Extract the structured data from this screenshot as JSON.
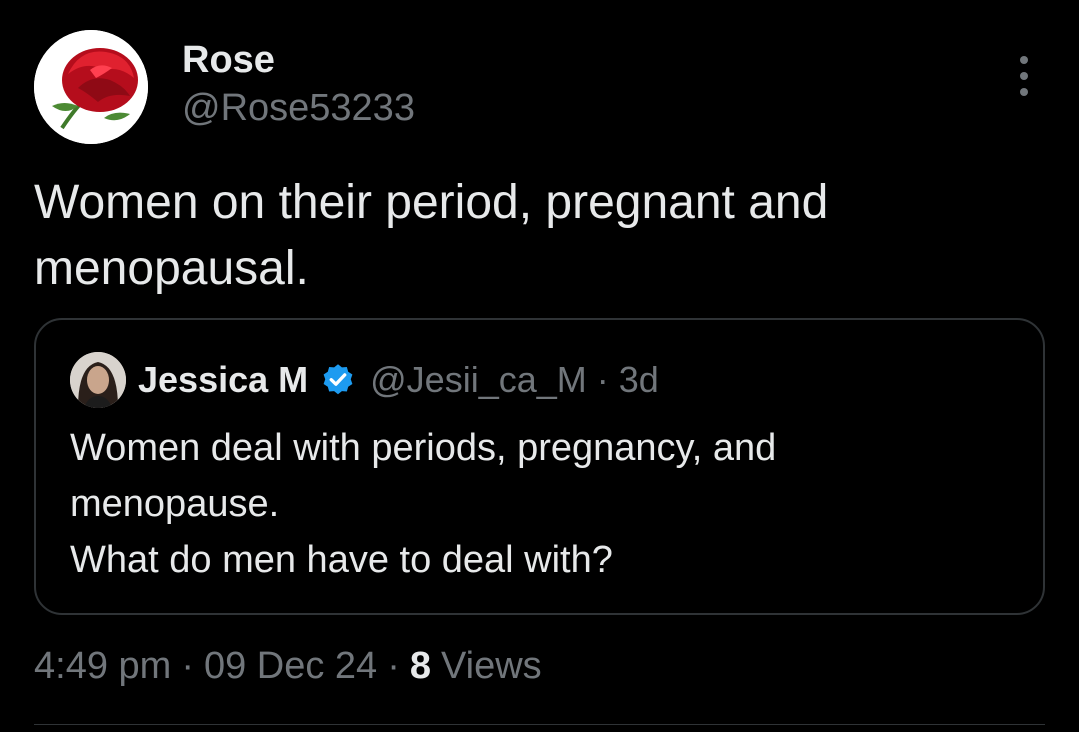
{
  "tweet": {
    "author": {
      "name": "Rose",
      "handle": "@Rose53233"
    },
    "text": "Women on their period, pregnant and\nmenopausal."
  },
  "quote": {
    "author": {
      "name": "Jessica M",
      "handle": "@Jesii_ca_M"
    },
    "separator": "·",
    "time": "3d",
    "text": "Women deal with periods, pregnancy, and\nmenopause.\nWhat do men have to deal with?"
  },
  "meta": {
    "time": "4:49 pm",
    "separator": "·",
    "date": "09 Dec 24",
    "views_count": "8",
    "views_label": "Views"
  },
  "icons": {
    "more": "more-options-icon",
    "verified": "verified-badge-icon"
  },
  "colors": {
    "background": "#000000",
    "text_primary": "#e7e9ea",
    "text_secondary": "#71767b",
    "border": "#2f3336",
    "verified_blue": "#1d9bf0",
    "rose_red": "#c8102e"
  }
}
